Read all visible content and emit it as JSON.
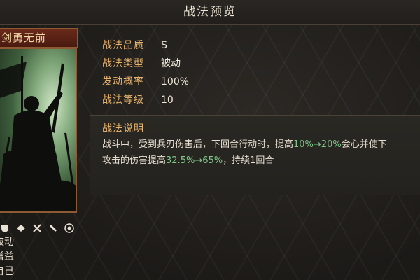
{
  "header": {
    "title": "战法预览"
  },
  "card": {
    "name": "剑勇无前",
    "info_lines": [
      "被动",
      "增益",
      "自己"
    ],
    "tag_icons": [
      "shield-icon",
      "arrow-icon",
      "crossed-swords-icon",
      "spear-icon",
      "target-icon"
    ]
  },
  "stats": [
    {
      "label": "战法品质",
      "value": "S"
    },
    {
      "label": "战法类型",
      "value": "被动"
    },
    {
      "label": "发动概率",
      "value": "100%"
    },
    {
      "label": "战法等级",
      "value": "10"
    }
  ],
  "description": {
    "heading": "战法说明",
    "line1": [
      "战斗中，受到兵刃伤害后，下回合行动时，提高",
      "10%→20%",
      "会心并使下"
    ],
    "line2": [
      "攻击的伤害提高",
      "32.5%→65%",
      "，持续1回合"
    ]
  },
  "colors": {
    "label": "#e8b26a",
    "highlight": "#7fc98a",
    "frame": "#8d5a34"
  }
}
